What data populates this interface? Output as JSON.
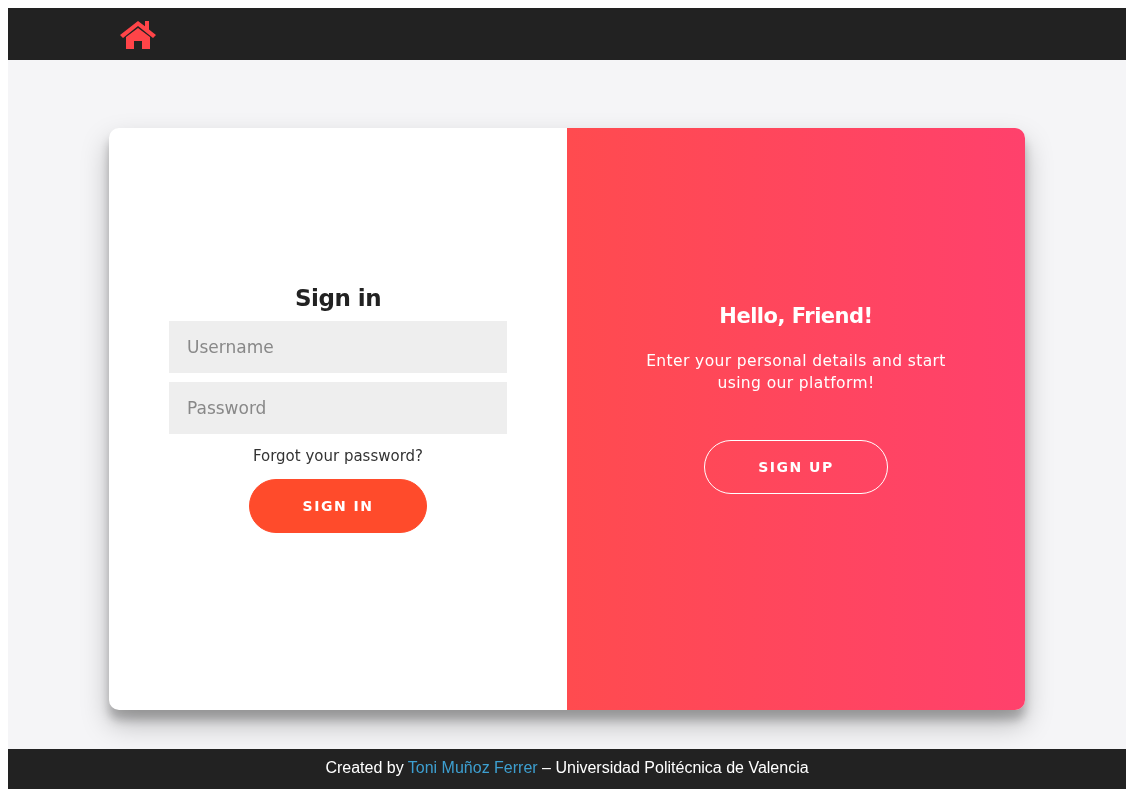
{
  "sign_in": {
    "title": "Sign in",
    "fields": [
      {
        "placeholder": "Username"
      },
      {
        "placeholder": "Password"
      }
    ],
    "forgot_link": "Forgot your password?",
    "button": "SIGN IN"
  },
  "overlay": {
    "title": "Hello, Friend!",
    "text": "Enter your personal details and start using our platform!",
    "button": "SIGN UP"
  },
  "footer": {
    "prefix": "Created by",
    "link": "Toni Muñoz Ferrer",
    "suffix": "– Universidad Politécnica de Valencia"
  }
}
